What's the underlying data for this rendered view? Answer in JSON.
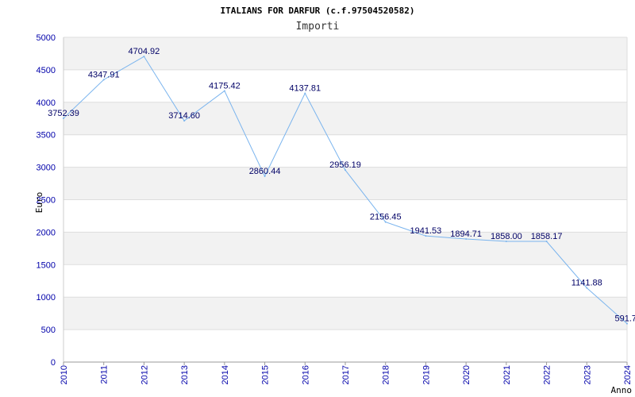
{
  "chart_data": {
    "type": "line",
    "title": "ITALIANS FOR DARFUR (c.f.97504520582)",
    "subtitle": "Importi",
    "xlabel": "Anno",
    "ylabel": "Euro",
    "ylim": [
      0,
      5000
    ],
    "ytick_step": 500,
    "yticks": [
      "0",
      "500",
      "1000",
      "1500",
      "2000",
      "2500",
      "3000",
      "3500",
      "4000",
      "4500",
      "5000"
    ],
    "grid": true,
    "line_color": "#7ab4ee",
    "band_color": "#f2f2f2",
    "categories": [
      "2010",
      "2011",
      "2012",
      "2013",
      "2014",
      "2015",
      "2016",
      "2017",
      "2018",
      "2019",
      "2020",
      "2021",
      "2022",
      "2023",
      "2024"
    ],
    "series": [
      {
        "values": [
          3752.39,
          4347.91,
          4704.92,
          3714.6,
          4175.42,
          2860.44,
          4137.81,
          2956.19,
          2156.45,
          1941.53,
          1894.71,
          1858.0,
          1858.17,
          1141.88,
          591.7
        ],
        "labels": [
          "3752.39",
          "4347.91",
          "4704.92",
          "3714.60",
          "4175.42",
          "2860.44",
          "4137.81",
          "2956.19",
          "2156.45",
          "1941.53",
          "1894.71",
          "1858.00",
          "1858.17",
          "1141.88",
          "591.7"
        ]
      }
    ]
  }
}
